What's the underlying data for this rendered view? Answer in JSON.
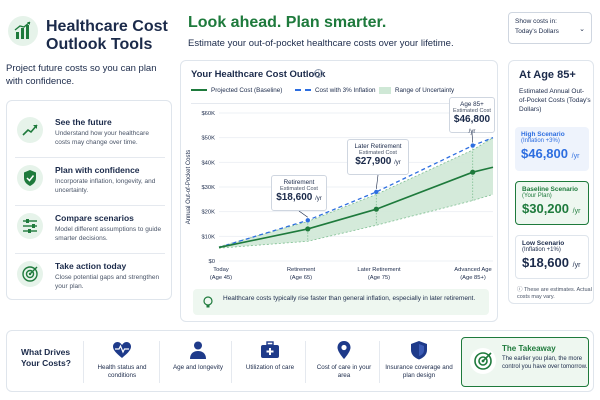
{
  "header": {
    "title": "Healthcare Cost Outlook Tools",
    "subtitle": "Project future costs so you can plan with confidence.",
    "headline": "Look ahead. Plan smarter.",
    "subheadline": "Estimate your out-of-pocket healthcare costs over your lifetime.",
    "show_costs_label": "Show costs in:",
    "show_costs_value": "Today's Dollars"
  },
  "features": [
    {
      "title": "See the future",
      "desc": "Understand how your healthcare costs may change over time.",
      "icon": "trend-up-icon"
    },
    {
      "title": "Plan with confidence",
      "desc": "Incorporate inflation, longevity, and uncertainty.",
      "icon": "shield-check-icon"
    },
    {
      "title": "Compare scenarios",
      "desc": "Model different assumptions to guide smarter decisions.",
      "icon": "sliders-icon"
    },
    {
      "title": "Take action today",
      "desc": "Close potential gaps and strengthen your plan.",
      "icon": "target-icon"
    }
  ],
  "chart_card": {
    "title": "Your Healthcare Cost Outlook",
    "note": "Healthcare costs typically rise faster than general inflation, especially in later retirement."
  },
  "callouts": [
    {
      "l1": "Retirement",
      "l2": "Estimated Cost",
      "value": "$18,600",
      "unit": "/yr"
    },
    {
      "l1": "Later Retirement",
      "l2": "Estimated Cost",
      "value": "$27,900",
      "unit": "/yr"
    },
    {
      "l1": "Age 85+",
      "l2": "Estimated Cost",
      "value": "$46,800",
      "unit": "/yr"
    }
  ],
  "chart_data": {
    "type": "line",
    "title": "Your Healthcare Cost Outlook",
    "ylabel": "Annual Out-of-Pocket Costs",
    "xlabel": "",
    "categories": [
      "Today (Age 45)",
      "Retirement (Age 65)",
      "Later Retirement (Age 75)",
      "Advanced Age (Age 85+)"
    ],
    "x_ticks": [
      {
        "l1": "Today",
        "l2": "(Age 45)"
      },
      {
        "l1": "Retirement",
        "l2": "(Age 65)"
      },
      {
        "l1": "Later Retirement",
        "l2": "(Age 75)"
      },
      {
        "l1": "Advanced Age",
        "l2": "(Age 85+)"
      }
    ],
    "y_ticks": [
      "$0",
      "$10K",
      "$20K",
      "$30K",
      "$40K",
      "$50K",
      "$60K"
    ],
    "ylim": [
      0,
      60000
    ],
    "legend": [
      "Projected Cost (Baseline)",
      "Cost with 3% Inflation",
      "Range of Uncertainty"
    ],
    "legend_position": "top",
    "series": [
      {
        "name": "Projected Cost (Baseline)",
        "x": [
          0,
          0.35,
          0.62,
          1.0,
          1.08
        ],
        "values": [
          5500,
          13000,
          21000,
          36000,
          38000
        ]
      },
      {
        "name": "Cost with 3% Inflation",
        "x": [
          0,
          0.35,
          0.62,
          1.0,
          1.08
        ],
        "values": [
          5500,
          16500,
          28000,
          46800,
          50000
        ]
      }
    ],
    "uncertainty": {
      "x": [
        0,
        0.35,
        0.62,
        1.0,
        1.08
      ],
      "upper": [
        5800,
        16000,
        27000,
        45000,
        50000
      ],
      "lower": [
        5200,
        8000,
        14500,
        24500,
        27000
      ]
    },
    "colors": {
      "baseline": "#1e7a3c",
      "inflation": "#2d6ee0",
      "range": "#cfe8d6"
    }
  },
  "age_panel": {
    "title": "At Age 85+",
    "subtitle": "Estimated Annual Out-of-Pocket Costs (Today's Dollars)",
    "scenarios": [
      {
        "name": "High Scenario",
        "sub": "(Inflation +3%)",
        "value": "$46,800",
        "unit": "/yr"
      },
      {
        "name": "Baseline Scenario",
        "sub": "(Your Plan)",
        "value": "$30,200",
        "unit": "/yr"
      },
      {
        "name": "Low Scenario",
        "sub": "(Inflation +1%)",
        "value": "$18,600",
        "unit": "/yr"
      }
    ],
    "footnote": "These are estimates. Actual costs may vary."
  },
  "bottom": {
    "title": "What Drives Your Costs?",
    "drivers": [
      {
        "label": "Health status and conditions",
        "icon": "heart-pulse-icon"
      },
      {
        "label": "Age and longevity",
        "icon": "person-icon"
      },
      {
        "label": "Utilization of care",
        "icon": "medical-kit-icon"
      },
      {
        "label": "Cost of care in your area",
        "icon": "location-icon"
      },
      {
        "label": "Insurance coverage and plan design",
        "icon": "shield-icon"
      }
    ],
    "takeaway_title": "The Takeaway",
    "takeaway_text": "The earlier you plan, the more control you have over tomorrow."
  }
}
